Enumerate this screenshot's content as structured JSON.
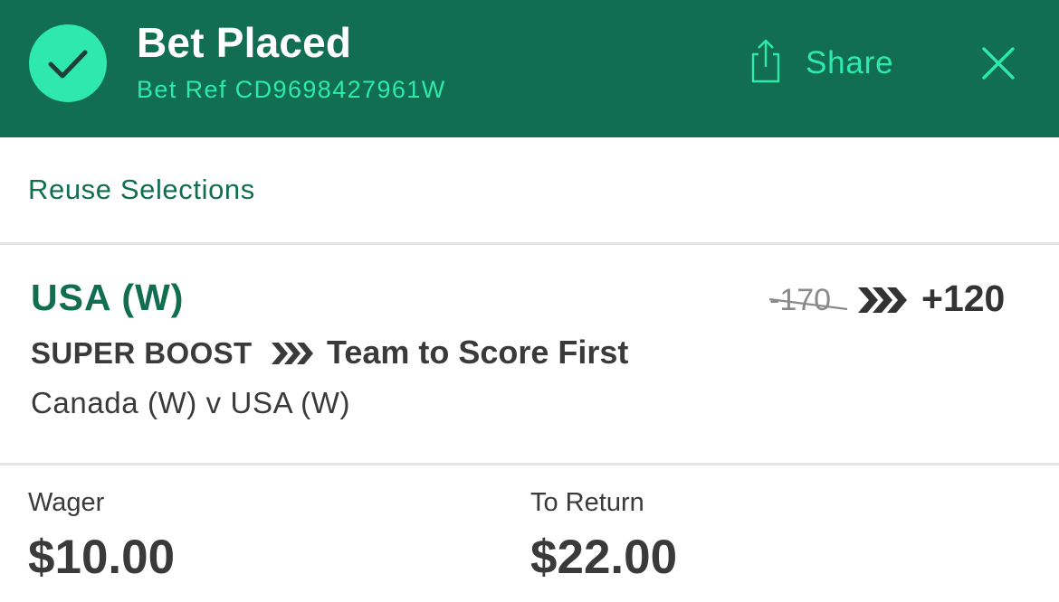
{
  "header": {
    "title": "Bet Placed",
    "bet_ref": "Bet Ref CD9698427961W",
    "share_label": "Share",
    "status_icon": "check-icon",
    "share_icon": "share-icon",
    "close_icon": "close-icon"
  },
  "reuse_label": "Reuse Selections",
  "bet": {
    "selection": "USA (W)",
    "old_odds": "-170",
    "new_odds": "+120",
    "boost_label": "SUPER BOOST",
    "market": "Team to Score First",
    "event": "Canada (W) v USA (W)"
  },
  "summary": {
    "wager_label": "Wager",
    "wager_value": "$10.00",
    "return_label": "To Return",
    "return_value": "$22.00"
  },
  "colors": {
    "header_bg": "#126e51",
    "accent": "#2ee8ad",
    "brand_green": "#126e51",
    "text_dark": "#3a3a3a",
    "text_muted": "#8a8a8a",
    "divider": "#e4e4e4"
  }
}
